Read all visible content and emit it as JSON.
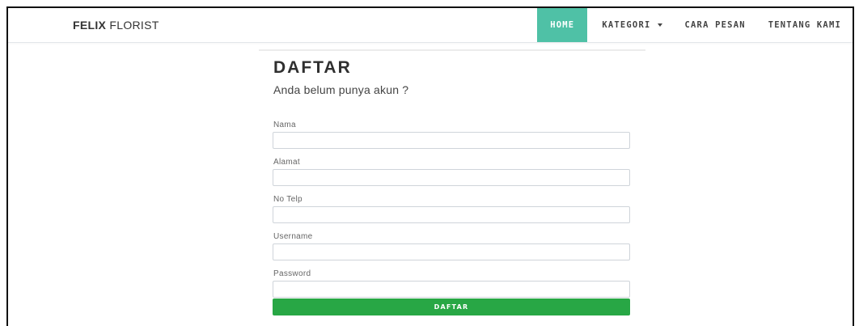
{
  "navbar": {
    "brand_bold": "FELIX",
    "brand_light": "FLORIST",
    "items": [
      {
        "label": "HOME",
        "active": true
      },
      {
        "label": "KATEGORI",
        "dropdown": true
      },
      {
        "label": "CARA PESAN"
      },
      {
        "label": "TENTANG KAMI"
      }
    ]
  },
  "form": {
    "title": "DAFTAR",
    "subtitle": "Anda belum punya akun ?",
    "fields": [
      {
        "label": "Nama",
        "value": ""
      },
      {
        "label": "Alamat",
        "value": ""
      },
      {
        "label": "No Telp",
        "value": ""
      },
      {
        "label": "Username",
        "value": ""
      },
      {
        "label": "Password",
        "value": ""
      }
    ],
    "submit_label": "DAFTAR"
  },
  "colors": {
    "active_nav": "#4fc1a6",
    "submit": "#28a745"
  }
}
